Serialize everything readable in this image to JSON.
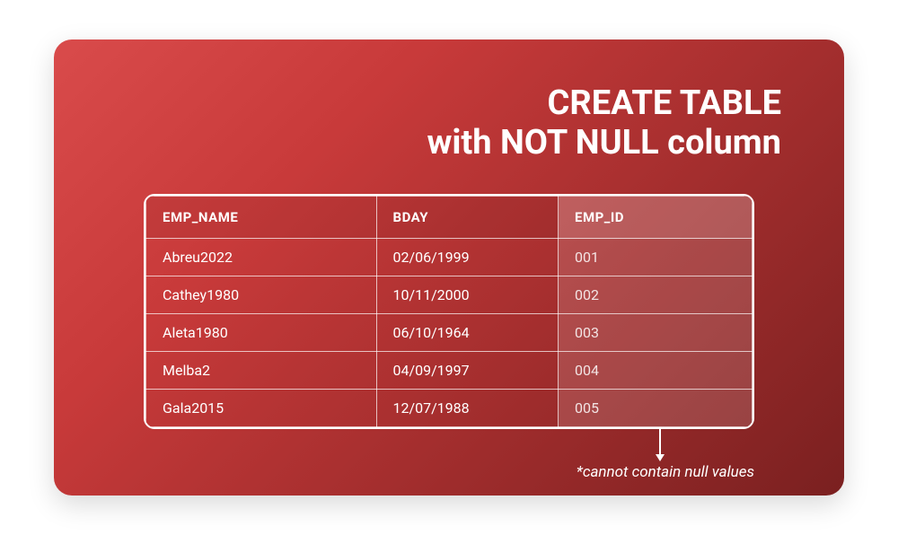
{
  "title_line1": "CREATE TABLE",
  "title_line2": "with NOT NULL column",
  "table": {
    "headers": {
      "emp_name": "EMP_NAME",
      "bday": "BDAY",
      "emp_id": "EMP_ID"
    },
    "rows": [
      {
        "emp_name": "Abreu2022",
        "bday": "02/06/1999",
        "emp_id": "001"
      },
      {
        "emp_name": "Cathey1980",
        "bday": "10/11/2000",
        "emp_id": "002"
      },
      {
        "emp_name": "Aleta1980",
        "bday": "06/10/1964",
        "emp_id": "003"
      },
      {
        "emp_name": "Melba2",
        "bday": "04/09/1997",
        "emp_id": "004"
      },
      {
        "emp_name": "Gala2015",
        "bday": "12/07/1988",
        "emp_id": "005"
      }
    ]
  },
  "annotation": "*cannot contain null values",
  "chart_data": {
    "type": "table",
    "title": "CREATE TABLE with NOT NULL column",
    "columns": [
      "EMP_NAME",
      "BDAY",
      "EMP_ID"
    ],
    "not_null_column": "EMP_ID",
    "rows": [
      [
        "Abreu2022",
        "02/06/1999",
        "001"
      ],
      [
        "Cathey1980",
        "10/11/2000",
        "002"
      ],
      [
        "Aleta1980",
        "06/10/1964",
        "003"
      ],
      [
        "Melba2",
        "04/09/1997",
        "004"
      ],
      [
        "Gala2015",
        "12/07/1988",
        "005"
      ]
    ],
    "annotation": "*cannot contain null values"
  }
}
